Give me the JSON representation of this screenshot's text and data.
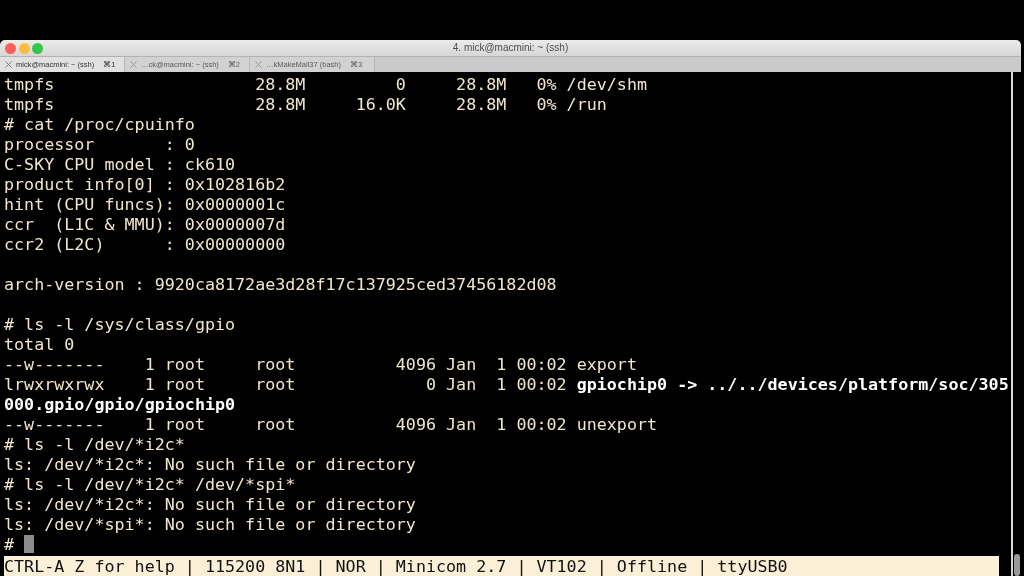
{
  "window": {
    "title": "4. mick@macmini: ~ (ssh)"
  },
  "tabs": [
    {
      "label": "mick@macmini: ~ (ssh)",
      "shortcut": "⌘1",
      "selected": true
    },
    {
      "label": "…ck@macmini: ~ (ssh)",
      "shortcut": "⌘2",
      "selected": false
    },
    {
      "label": "…kMakeMail37 (bash)",
      "shortcut": "⌘3",
      "selected": false
    }
  ],
  "terminal": {
    "blocks": [
      [
        {
          "text": "tmpfs                    28.8M         0     28.8M   0% /dev/shm"
        },
        {
          "text": "tmpfs                    28.8M     16.0K     28.8M   0% /run"
        },
        {
          "text": "# cat /proc/cpuinfo"
        },
        {
          "text": "processor       : 0"
        },
        {
          "text": "C-SKY CPU model : ck610"
        },
        {
          "text": "product info[0] : 0x102816b2"
        },
        {
          "text": "hint (CPU funcs): 0x0000001c"
        },
        {
          "text": "ccr  (L1C & MMU): 0x0000007d"
        },
        {
          "text": "ccr2 (L2C)      : 0x00000000"
        }
      ],
      [
        {
          "text": "arch-version : 9920ca8172ae3d28f17c137925ced37456182d08"
        }
      ],
      [
        {
          "text": "# ls -l /sys/class/gpio"
        },
        {
          "text": "total 0"
        },
        {
          "text": "--w-------    1 root     root          4096 Jan  1 00:02 export"
        },
        {
          "text": "lrwxrwxrwx    1 root     root             0 Jan  1 00:02 ",
          "bold_text": "gpiochip0 -> ../../devices/platform/soc/305"
        },
        {
          "bold_text": "000.gpio/gpio/gpiochip0"
        },
        {
          "text": "--w-------    1 root     root          4096 Jan  1 00:02 unexport"
        },
        {
          "text": "# ls -l /dev/*i2c*"
        },
        {
          "text": "ls: /dev/*i2c*: No such file or directory"
        },
        {
          "text": "# ls -l /dev/*i2c* /dev/*spi*"
        },
        {
          "text": "ls: /dev/*i2c*: No such file or directory"
        },
        {
          "text": "ls: /dev/*spi*: No such file or directory"
        },
        {
          "text": "# "
        }
      ]
    ],
    "cursor": true,
    "status_line": "CTRL-A Z for help | 115200 8N1 | NOR | Minicom 2.7 | VT102 | Offline | ttyUSB0"
  }
}
